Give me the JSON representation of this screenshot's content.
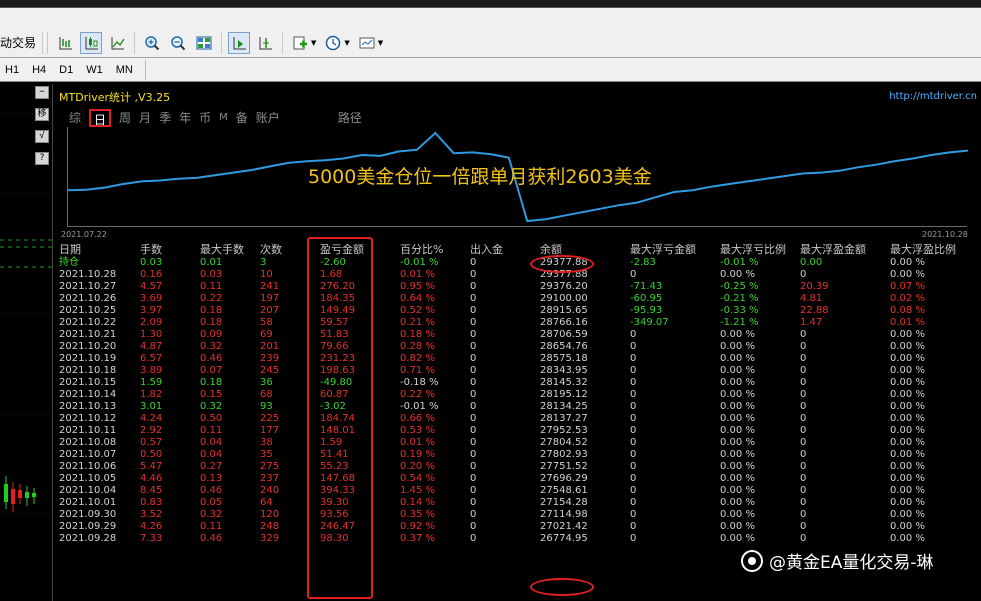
{
  "toolbar": {
    "label": "动交易",
    "icons": [
      "bar-chart-icon",
      "candlestick-icon",
      "line-chart-icon",
      "zoom-in-icon",
      "zoom-out-icon",
      "tile-windows-icon",
      "chart-shift-icon",
      "autoscroll-icon",
      "indicators-icon",
      "periodicity-icon",
      "templates-icon"
    ]
  },
  "periods": [
    "H1",
    "H4",
    "D1",
    "W1",
    "MN"
  ],
  "side_buttons": [
    "−",
    "移",
    "√",
    "?"
  ],
  "panel": {
    "title": "MTDriver统计 ,V3.25",
    "url": "http://mtdriver.cn",
    "tabs": [
      "综",
      "日",
      "周",
      "月",
      "季",
      "年",
      "币",
      "M",
      "备",
      "账户",
      "路径"
    ],
    "selected_tab": "日",
    "chart_start": "2021.07.22",
    "chart_end": "2021.10.28",
    "overlay_text": "5000美金仓位一倍跟单月获利2603美金"
  },
  "table": {
    "headers": [
      "日期",
      "手数",
      "最大手数",
      "次数",
      "盈亏金额",
      "百分比%",
      "出入金",
      "余额",
      "最大浮亏金额",
      "最大浮亏比例",
      "最大浮盈金额",
      "最大浮盈比例"
    ],
    "rows": [
      {
        "c": [
          "持仓",
          "0.03",
          "0.01",
          "3",
          "-2.60",
          "-0.01 %",
          "0",
          "29377.88",
          "-2.83",
          "-0.01 %",
          "0.00",
          "0.00 %"
        ],
        "t": "ggggggwwgggw"
      },
      {
        "c": [
          "2021.10.28",
          "0.16",
          "0.03",
          "10",
          "1.68",
          "0.01 %",
          "0",
          "29377.88",
          "0",
          "0.00 %",
          "0",
          "0.00 %"
        ],
        "t": "wrrrrrwwwwww"
      },
      {
        "c": [
          "2021.10.27",
          "4.57",
          "0.11",
          "241",
          "276.20",
          "0.95 %",
          "0",
          "29376.20",
          "-71.43",
          "-0.25 %",
          "20.39",
          "0.07 %"
        ],
        "t": "wrrrrrwwggrr"
      },
      {
        "c": [
          "2021.10.26",
          "3.69",
          "0.22",
          "197",
          "184.35",
          "0.64 %",
          "0",
          "29100.00",
          "-60.95",
          "-0.21 %",
          "4.81",
          "0.02 %"
        ],
        "t": "wrrrrrwwggrr"
      },
      {
        "c": [
          "2021.10.25",
          "3.97",
          "0.18",
          "207",
          "149.49",
          "0.52 %",
          "0",
          "28915.65",
          "-95.93",
          "-0.33 %",
          "22.88",
          "0.08 %"
        ],
        "t": "wrrrrrwwggrr"
      },
      {
        "c": [
          "2021.10.22",
          "2.09",
          "0.18",
          "58",
          "59.57",
          "0.21 %",
          "0",
          "28766.16",
          "-349.07",
          "-1.21 %",
          "1.47",
          "0.01 %"
        ],
        "t": "wrrrrrwwggrr"
      },
      {
        "c": [
          "2021.10.21",
          "1.30",
          "0.09",
          "69",
          "51.83",
          "0.18 %",
          "0",
          "28706.59",
          "0",
          "0.00 %",
          "0",
          "0.00 %"
        ],
        "t": "wrrrrrwwwwww"
      },
      {
        "c": [
          "2021.10.20",
          "4.87",
          "0.32",
          "201",
          "79.66",
          "0.28 %",
          "0",
          "28654.76",
          "0",
          "0.00 %",
          "0",
          "0.00 %"
        ],
        "t": "wrrrrrwwwwww"
      },
      {
        "c": [
          "2021.10.19",
          "6.57",
          "0.46",
          "239",
          "231.23",
          "0.82 %",
          "0",
          "28575.18",
          "0",
          "0.00 %",
          "0",
          "0.00 %"
        ],
        "t": "wrrrrrwwwwww"
      },
      {
        "c": [
          "2021.10.18",
          "3.89",
          "0.07",
          "245",
          "198.63",
          "0.71 %",
          "0",
          "28343.95",
          "0",
          "0.00 %",
          "0",
          "0.00 %"
        ],
        "t": "wrrrrrwwwwww"
      },
      {
        "c": [
          "2021.10.15",
          "1.59",
          "0.18",
          "36",
          "-49.80",
          "-0.18 %",
          "0",
          "28145.32",
          "0",
          "0.00 %",
          "0",
          "0.00 %"
        ],
        "t": "wggggwwwwwww"
      },
      {
        "c": [
          "2021.10.14",
          "1.82",
          "0.15",
          "68",
          "60.87",
          "0.22 %",
          "0",
          "28195.12",
          "0",
          "0.00 %",
          "0",
          "0.00 %"
        ],
        "t": "wrrrrrwwwwww"
      },
      {
        "c": [
          "2021.10.13",
          "3.01",
          "0.32",
          "93",
          "-3.02",
          "-0.01 %",
          "0",
          "28134.25",
          "0",
          "0.00 %",
          "0",
          "0.00 %"
        ],
        "t": "wggggwwwwwww"
      },
      {
        "c": [
          "2021.10.12",
          "4.24",
          "0.50",
          "225",
          "184.74",
          "0.66 %",
          "0",
          "28137.27",
          "0",
          "0.00 %",
          "0",
          "0.00 %"
        ],
        "t": "wrrrrrwwwwww"
      },
      {
        "c": [
          "2021.10.11",
          "2.92",
          "0.11",
          "177",
          "148.01",
          "0.53 %",
          "0",
          "27952.53",
          "0",
          "0.00 %",
          "0",
          "0.00 %"
        ],
        "t": "wrrrrrwwwwww"
      },
      {
        "c": [
          "2021.10.08",
          "0.57",
          "0.04",
          "38",
          "1.59",
          "0.01 %",
          "0",
          "27804.52",
          "0",
          "0.00 %",
          "0",
          "0.00 %"
        ],
        "t": "wrrrrrwwwwww"
      },
      {
        "c": [
          "2021.10.07",
          "0.50",
          "0.04",
          "35",
          "51.41",
          "0.19 %",
          "0",
          "27802.93",
          "0",
          "0.00 %",
          "0",
          "0.00 %"
        ],
        "t": "wrrrrrwwwwww"
      },
      {
        "c": [
          "2021.10.06",
          "5.47",
          "0.27",
          "275",
          "55.23",
          "0.20 %",
          "0",
          "27751.52",
          "0",
          "0.00 %",
          "0",
          "0.00 %"
        ],
        "t": "wrrrrrwwwwww"
      },
      {
        "c": [
          "2021.10.05",
          "4.46",
          "0.13",
          "237",
          "147.68",
          "0.54 %",
          "0",
          "27696.29",
          "0",
          "0.00 %",
          "0",
          "0.00 %"
        ],
        "t": "wrrrrrwwwwww"
      },
      {
        "c": [
          "2021.10.04",
          "8.45",
          "0.46",
          "240",
          "394.33",
          "1.45 %",
          "0",
          "27548.61",
          "0",
          "0.00 %",
          "0",
          "0.00 %"
        ],
        "t": "wrrrrrwwwwww"
      },
      {
        "c": [
          "2021.10.01",
          "0.83",
          "0.05",
          "64",
          "39.30",
          "0.14 %",
          "0",
          "27154.28",
          "0",
          "0.00 %",
          "0",
          "0.00 %"
        ],
        "t": "wrrrrrwwwwww"
      },
      {
        "c": [
          "2021.09.30",
          "3.52",
          "0.32",
          "120",
          "93.56",
          "0.35 %",
          "0",
          "27114.98",
          "0",
          "0.00 %",
          "0",
          "0.00 %"
        ],
        "t": "wrrrrrwwwwww"
      },
      {
        "c": [
          "2021.09.29",
          "4.26",
          "0.11",
          "248",
          "246.47",
          "0.92 %",
          "0",
          "27021.42",
          "0",
          "0.00 %",
          "0",
          "0.00 %"
        ],
        "t": "wrrrrrwwwwww"
      },
      {
        "c": [
          "2021.09.28",
          "7.33",
          "0.46",
          "329",
          "98.30",
          "0.37 %",
          "0",
          "26774.95",
          "0",
          "0.00 %",
          "0",
          "0.00 %"
        ],
        "t": "wrrrrrwwwwww"
      }
    ]
  },
  "equity_chart": {
    "x_start": "2021.07.22",
    "x_end": "2021.10.28",
    "values": [
      26150,
      26170,
      26300,
      26500,
      26650,
      26700,
      26800,
      26850,
      27000,
      27150,
      27300,
      27500,
      27700,
      27800,
      27850,
      27950,
      28150,
      28100,
      28350,
      28450,
      29400,
      28250,
      28300,
      28200,
      28000,
      24400,
      24500,
      24700,
      24900,
      25100,
      25300,
      25450,
      25750,
      26050,
      26150,
      26350,
      26500,
      26650,
      26800,
      26950,
      27100,
      27150,
      27250,
      27450,
      27600,
      27800,
      27950,
      28150,
      28300,
      28400
    ]
  },
  "watermark": "@黄金EA量化交易-琳",
  "colors": {
    "positive": "#e5312c",
    "negative": "#39d52d",
    "neutral": "#d2d2d2",
    "highlight": "#e02020",
    "curve": "#2e9be0"
  }
}
